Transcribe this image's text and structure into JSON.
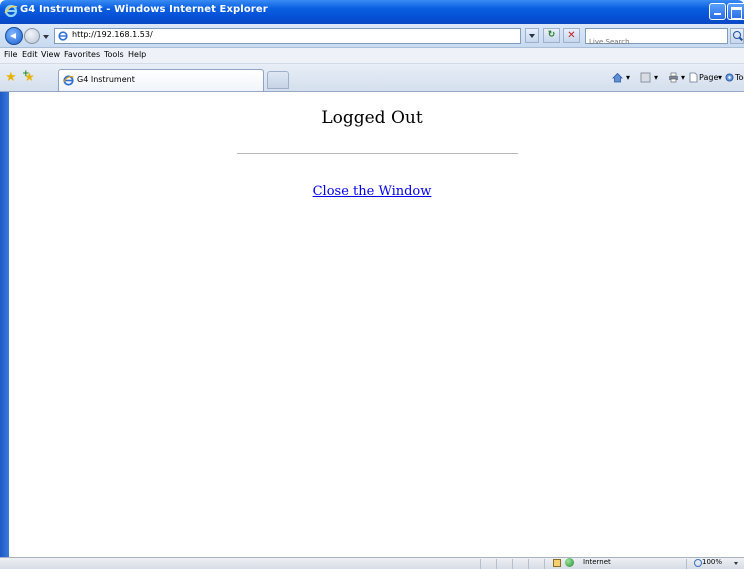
{
  "window": {
    "title": "G4 Instrument - Windows Internet Explorer"
  },
  "address_bar": {
    "url": "http://192.168.1.53/",
    "search_placeholder": "Live Search"
  },
  "menu": [
    "File",
    "Edit",
    "View",
    "Favorites",
    "Tools",
    "Help"
  ],
  "tab": {
    "label": "G4 Instrument"
  },
  "commands": {
    "page_label": "Page",
    "tools_label": "Tools"
  },
  "content": {
    "heading": "Logged Out",
    "close_link": "Close the Window"
  },
  "status": {
    "zone": "Internet",
    "zoom": "100%"
  },
  "colors": {
    "titlebar": "#0550d6",
    "link": "#0000ee"
  }
}
